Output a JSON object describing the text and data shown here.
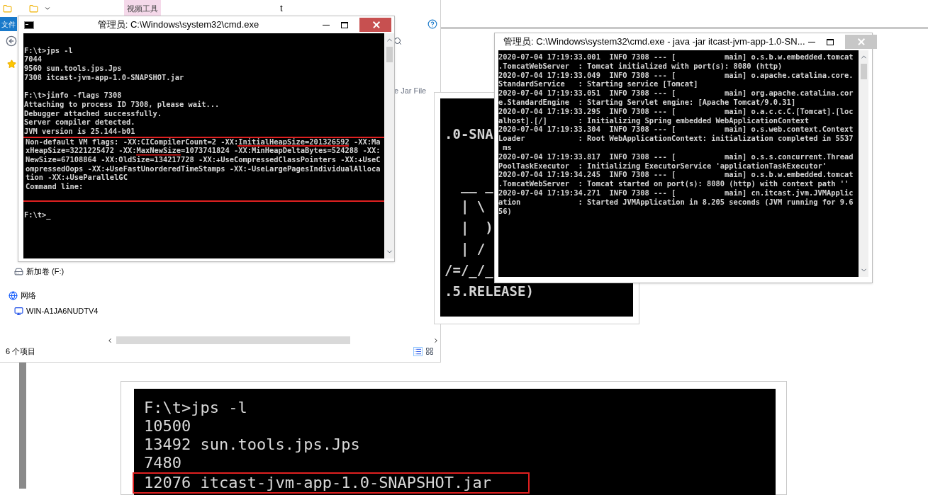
{
  "explorer": {
    "title": "t",
    "contextual_tab": "视频工具",
    "ribbon_tab": "文件",
    "column_text": "e Jar File",
    "nav_items": [
      {
        "label": "新加卷 (F:)",
        "kind": "drive"
      },
      {
        "label": "网络",
        "kind": "network"
      },
      {
        "label": "WIN-A1JA6NUDTV4",
        "kind": "computer"
      }
    ],
    "status": "6 个项目"
  },
  "cmd_window": {
    "title": "管理员: C:\\Windows\\system32\\cmd.exe",
    "blocks": [
      {
        "highlighted": false,
        "lines": [
          "F:\\t>jps -l",
          "7044",
          "9560 sun.tools.jps.Jps",
          "7308 itcast-jvm-app-1.0-SNAPSHOT.jar"
        ]
      },
      {
        "highlighted": false,
        "lines": [
          "F:\\t>jinfo -flags 7308",
          "Attaching to process ID 7308, please wait...",
          "Debugger attached successfully.",
          "Server compiler detected.",
          "JVM version is 25.144-b01"
        ]
      },
      {
        "highlighted": true,
        "lines": [
          "Non-default VM flags: -XX:CICompilerCount=2 -XX:InitialHeapSize=201326592 -XX:Ma",
          "xHeapSize=3221225472 -XX:MaxNewSize=1073741824 -XX:MinHeapDeltaBytes=524288 -XX:",
          "NewSize=67108864 -XX:OldSize=134217728 -XX:+UseCompressedClassPointers -XX:+UseC",
          "ompressedOops -XX:+UseFastUnorderedTimeStamps -XX:-UseLargePagesIndividualAlloca",
          "tion -XX:+UseParallelGC",
          "Command line:"
        ]
      },
      {
        "highlighted": false,
        "lines": [
          "F:\\t>_"
        ]
      }
    ]
  },
  "banner": {
    "lines": [
      ".0-SNA",
      "  __ _",
      "  | \\",
      "  |  )",
      "  | /",
      "/=/_/_",
      ".5.RELEASE)"
    ]
  },
  "java_window": {
    "title": "管理员: C:\\Windows\\system32\\cmd.exe - java  -jar itcast-jvm-app-1.0-SN...",
    "lines": [
      "2020-07-04 17:19:33.001  INFO 7308 --- [           main] o.s.b.w.embedded.tomcat",
      ".TomcatWebServer  : Tomcat initialized with port(s): 8080 (http)",
      "2020-07-04 17:19:33.049  INFO 7308 --- [           main] o.apache.catalina.core.",
      "StandardService   : Starting service [Tomcat]",
      "2020-07-04 17:19:33.051  INFO 7308 --- [           main] org.apache.catalina.cor",
      "e.StandardEngine  : Starting Servlet engine: [Apache Tomcat/9.0.31]",
      "2020-07-04 17:19:33.295  INFO 7308 --- [           main] o.a.c.c.C.[Tomcat].[loc",
      "alhost].[/]       : Initializing Spring embedded WebApplicationContext",
      "2020-07-04 17:19:33.304  INFO 7308 --- [           main] o.s.web.context.Context",
      "Loader            : Root WebApplicationContext: initialization completed in 5537",
      " ms",
      "2020-07-04 17:19:33.817  INFO 7308 --- [           main] o.s.s.concurrent.Thread",
      "PoolTaskExecutor  : Initializing ExecutorService 'applicationTaskExecutor'",
      "2020-07-04 17:19:34.245  INFO 7308 --- [           main] o.s.b.w.embedded.tomcat",
      ".TomcatWebServer  : Tomcat started on port(s): 8080 (http) with context path ''",
      "2020-07-04 17:19:34.271  INFO 7308 --- [           main] cn.itcast.jvm.JVMApplic",
      "ation             : Started JVMApplication in 8.205 seconds (JVM running for 9.6",
      "56)"
    ]
  },
  "bottom_console": {
    "blocks": [
      {
        "highlighted": false,
        "lines": [
          "F:\\t>jps -l",
          "10500",
          "13492 sun.tools.jps.Jps",
          "7480"
        ]
      },
      {
        "highlighted": true,
        "lines": [
          "12076 itcast-jvm-app-1.0-SNAPSHOT.jar"
        ]
      }
    ]
  }
}
